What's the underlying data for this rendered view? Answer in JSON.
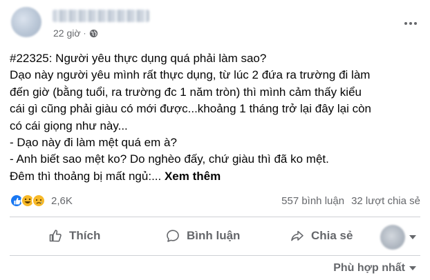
{
  "post": {
    "time": "22 giờ",
    "separator": "·",
    "content": {
      "lines": [
        "#22325: Người yêu thực dụng quá phải làm sao?",
        "Dạo này người yêu mình rất thực dụng, từ lúc 2 đứa ra trường đi làm",
        "đến giờ (bằng tuổi, ra trường đc 1 năm tròn) thì mình cảm thấy kiểu",
        "cái gì cũng phải giàu có mới được...khoảng 1 tháng trở lại đây lại còn",
        "có cái giọng như này...",
        "- Dạo này đi làm mệt quá em à?",
        "- Anh biết sao mệt ko? Do nghèo đấy, chứ giàu thì đã ko mệt.",
        "Đêm thì thoảng bị mất ngủ:..."
      ],
      "see_more": "Xem thêm"
    },
    "reactions": {
      "icons": [
        "like-icon",
        "haha-icon",
        "sad-icon"
      ],
      "count": "2,6K"
    },
    "comments": "557 bình luận",
    "shares": "32 lượt chia sẻ",
    "actions": {
      "like": "Thích",
      "comment": "Bình luận",
      "share": "Chia sẻ"
    },
    "sort": "Phù hợp nhất"
  },
  "colors": {
    "text": "#050505",
    "secondary": "#65676b",
    "like_blue": "#1877f2",
    "reaction_yellow": "#f7b928",
    "divider": "#ced0d4"
  }
}
